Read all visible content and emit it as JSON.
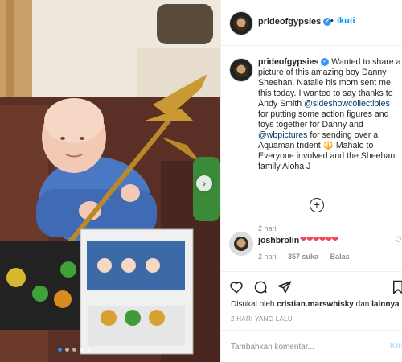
{
  "post": {
    "photo_alt_icon": "photo-post",
    "carousel_dots": 5,
    "carousel_active": 1
  },
  "header": {
    "username": "prideofgypsies",
    "separator": "•",
    "follow_label": "Ikuti"
  },
  "caption": {
    "username": "prideofgypsies",
    "text_1": " Wanted to share a picture of this amazing boy Danny Sheehan. Natalie his mom sent me this today. I wanted to say thanks to Andy Smith ",
    "mention_1": "@sideshowcollectibles",
    "text_2": " for putting some action figures and toys together for Danny and ",
    "mention_2": "@wbpictures",
    "text_3": " for sending over a Aquaman trident ",
    "emoji": "🔱",
    "text_4": " Mahalo to Everyone involved and the Sheehan family Aloha J",
    "time": "2 hari"
  },
  "comment": {
    "username": "joshbrolin",
    "text": "❤❤❤❤❤❤",
    "time": "2 hari",
    "likes": "357 suka",
    "reply_label": "Balas"
  },
  "liked_by": {
    "prefix": "Disukai oleh ",
    "user": "cristian.marswhisky",
    "middle": " dan ",
    "others": "lainnya"
  },
  "timestamp": "2 HARI YANG LALU",
  "add_comment": {
    "placeholder": "Tambahkan komentar...",
    "send_label": "Kirim"
  },
  "colors": {
    "link": "#00376b",
    "follow": "#0095f6",
    "heart": "#ed4956",
    "verified": "#3897f0"
  }
}
